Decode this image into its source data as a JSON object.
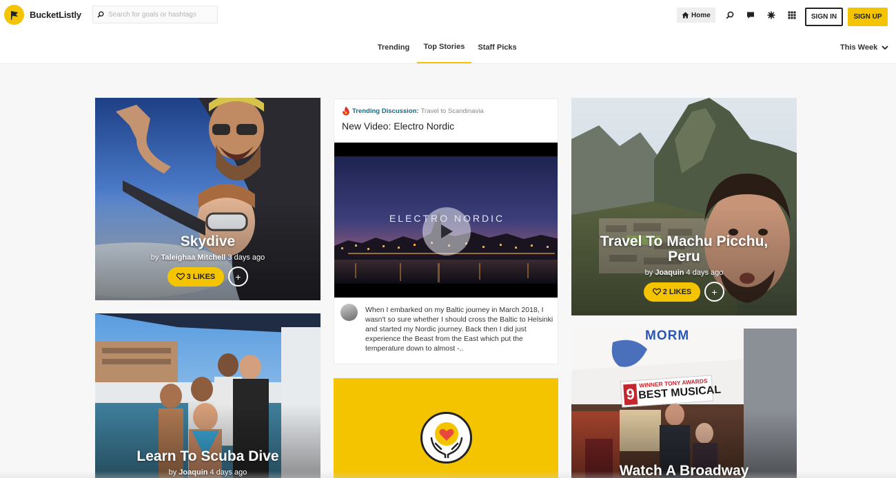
{
  "brand": {
    "name": "BucketListly"
  },
  "search": {
    "placeholder": "Search for goals or hashtags"
  },
  "nav": {
    "home_label": "Home",
    "signin_label": "SIGN IN",
    "signup_label": "SIGN UP"
  },
  "tabs": [
    {
      "label": "Trending",
      "active": false
    },
    {
      "label": "Top Stories",
      "active": true
    },
    {
      "label": "Staff Picks",
      "active": false
    }
  ],
  "period": {
    "selected": "This Week"
  },
  "cards": {
    "skydive": {
      "title": "Skydive",
      "by": "by",
      "author": "Taleighaa Mitchell",
      "time": "3 days ago",
      "likes": "3 LIKES",
      "add": "+"
    },
    "scuba": {
      "title": "Learn To Scuba Dive",
      "by": "by",
      "author": "Joaquin",
      "time": "4 days ago"
    },
    "discussion": {
      "label": "Trending Discussion:",
      "topic": "Travel to Scandinavia",
      "title": "New Video: Electro Nordic",
      "video_title": "ELECTRO NORDIC",
      "excerpt": "When I embarked on my Baltic journey in March 2018, I wasn't so sure whether I should cross the Baltic to Helsinki and started my Nordic journey. Back then I did just experience the Beast from the East which put the temperature down to almost -.."
    },
    "machu": {
      "title": "Travel To Machu Picchu, Peru",
      "by": "by",
      "author": "Joaquin",
      "time": "4 days ago",
      "likes": "2 LIKES",
      "add": "+"
    },
    "broadway": {
      "title": "Watch A Broadway",
      "sign_line1": "WINNER TONY AWARDS",
      "sign_num": "9",
      "sign_line2": "BEST MUSICAL",
      "marquee": "MORM"
    }
  },
  "colors": {
    "accent": "#f5c400",
    "discussion_label": "#0b6e8a"
  }
}
